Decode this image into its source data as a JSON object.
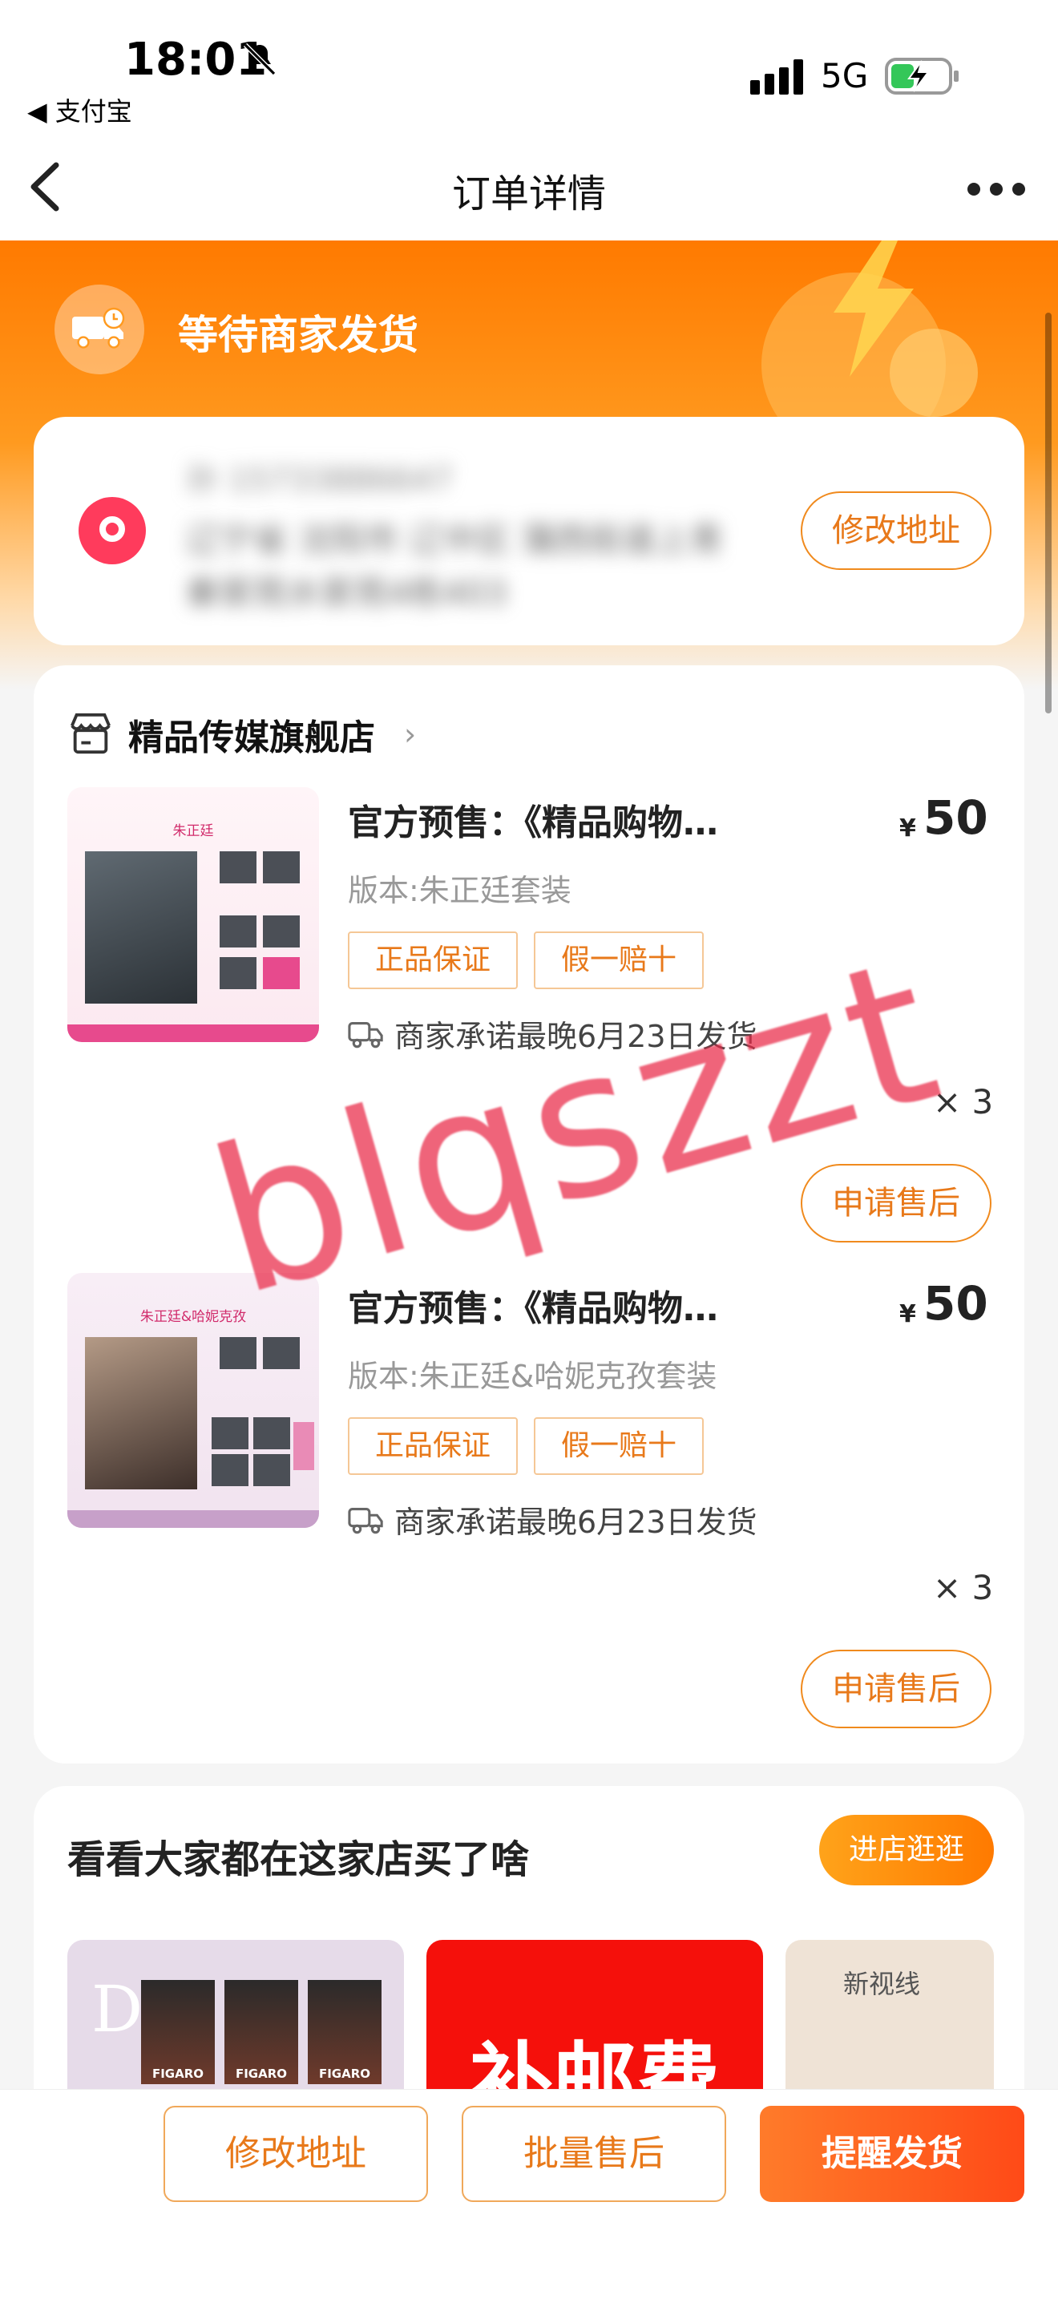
{
  "status_bar": {
    "time": "18:01",
    "back_app": "◀ 支付宝",
    "network": "5G"
  },
  "nav": {
    "title": "订单详情"
  },
  "order_status": {
    "text": "等待商家发货",
    "icon": "delivery-truck-icon"
  },
  "address": {
    "name_phone": "孙  15733886647",
    "line1": "辽宁省 沈阳市 辽中区 蒲西街道上青",
    "line2": "秦家苑水家苑4栋403",
    "edit_label": "修改地址"
  },
  "shop": {
    "name": "精品传媒旗舰店",
    "arrow": "›"
  },
  "items": [
    {
      "thumb_title": "朱正廷",
      "title": "官方预售：《精品购物…",
      "currency": "¥",
      "price": "50",
      "spec": "版本:朱正廷套装",
      "tags": [
        "正品保证",
        "假一赔十"
      ],
      "shipping": "商家承诺最晚6月23日发货",
      "qty": "× 3",
      "after_sale": "申请售后"
    },
    {
      "thumb_title": "朱正廷&哈妮克孜",
      "title": "官方预售：《精品购物…",
      "currency": "¥",
      "price": "50",
      "spec": "版本:朱正廷&哈妮克孜套装",
      "tags": [
        "正品保证",
        "假一赔十"
      ],
      "shipping": "商家承诺最晚6月23日发货",
      "qty": "× 3",
      "after_sale": "申请售后"
    }
  ],
  "recommend": {
    "title": "看看大家都在这家店买了啥",
    "visit_label": "进店逛逛",
    "items": [
      {
        "text": "D.",
        "mag": "FIGARO"
      },
      {
        "text": "补邮费"
      },
      {
        "text": "新视线"
      }
    ]
  },
  "bottom_bar": {
    "edit_address": "修改地址",
    "batch_after_sale": "批量售后",
    "remind_ship": "提醒发货"
  },
  "watermark": "blqszzt",
  "colors": {
    "accent": "#ff7a00",
    "primary_button": "#ff4a17",
    "pin": "#ff3b5c",
    "tag_text": "#e8791a"
  }
}
